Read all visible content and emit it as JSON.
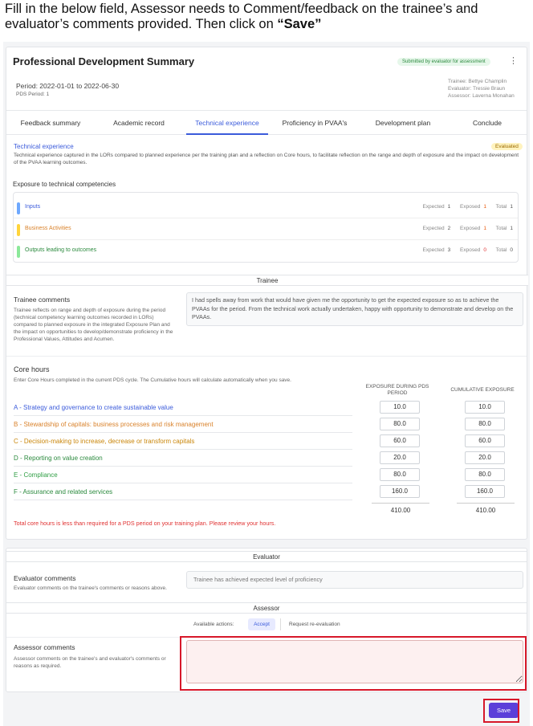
{
  "instruction": {
    "text": "Fill in the below field, Assessor needs to Comment/feedback on the trainee’s and evaluator’s comments provided. Then click on ",
    "emphasis": "“Save”"
  },
  "header": {
    "title": "Professional Development Summary",
    "status_badge": "Submitted by evaluator for assessment",
    "period": "Period: 2022-01-01 to 2022-06-30",
    "pds_period": "PDS Period: 1",
    "trainee": "Trainee:  Bettye Champlin",
    "evaluator": "Evaluator:  Tressie Braun",
    "assessor": "Assessor:  Laverna Monahan"
  },
  "tabs": [
    "Feedback summary",
    "Academic record",
    "Technical experience",
    "Proficiency in PVAA's",
    "Development plan",
    "Conclude"
  ],
  "tech": {
    "title": "Technical experience",
    "badge": "Evaluated",
    "description": "Technical experience captured in the LORs compared to planned experience per the training plan and a reflection on Core hours, to facilitate reflection on the range and depth of exposure and the impact on development of the PVAA learning outcomes.",
    "exposure_heading": "Exposure to technical competencies",
    "competencies": [
      {
        "label": "Inputs",
        "color": "#6ea8fe",
        "text_color": "#3b5bdb",
        "expected": "1",
        "exposed": "1",
        "total": "1",
        "exposed_color": "#e8590c"
      },
      {
        "label": "Business Activities",
        "color": "#ffd43b",
        "text_color": "#d9822b",
        "expected": "2",
        "exposed": "1",
        "total": "1",
        "exposed_color": "#e8590c"
      },
      {
        "label": "Outputs leading to outcomes",
        "color": "#8ce99a",
        "text_color": "#2b8a3e",
        "expected": "3",
        "exposed": "0",
        "total": "0",
        "exposed_color": "#e03131"
      }
    ],
    "labels": {
      "expected": "Expected",
      "exposed": "Exposed",
      "total": "Total"
    }
  },
  "trainee": {
    "section": "Trainee",
    "comments_title": "Trainee comments",
    "comments_help": "Trainee reflects on range and depth of exposure during the period (technical competency learning outcomes recorded in LORs) compared to planned exposure in the integrated Exposure Plan and the impact on opportunities to develop/demonstrate proficiency in the Professional Values, Attitudes and Acumen.",
    "comment_value": "I had spells away from work that would have given me the opportunity to get the expected exposure so as to achieve the PVAAs for the period. From the technical work actually undertaken, happy with opportunity to demonstrate and develop on the PVAAs."
  },
  "core_hours": {
    "title": "Core hours",
    "help": "Enter Core Hours completed in the current PDS cycle. The Cumulative hours will calculate automatically when you save.",
    "col_period": "EXPOSURE DURING PDS PERIOD",
    "col_cumulative": "CUMULATIVE EXPOSURE",
    "rows": [
      {
        "label": "A - Strategy and governance to create sustainable value",
        "color": "#3b5bdb",
        "period": "10.0",
        "cumulative": "10.0"
      },
      {
        "label": "B - Stewardship of capitals: business processes and risk management",
        "color": "#d9822b",
        "period": "80.0",
        "cumulative": "80.0"
      },
      {
        "label": "C - Decision-making to increase, decrease or transform capitals",
        "color": "#c9860a",
        "period": "60.0",
        "cumulative": "60.0"
      },
      {
        "label": "D - Reporting on value creation",
        "color": "#2b8a3e",
        "period": "20.0",
        "cumulative": "20.0"
      },
      {
        "label": "E - Compliance",
        "color": "#2f9e44",
        "period": "80.0",
        "cumulative": "80.0"
      },
      {
        "label": "F - Assurance and related services",
        "color": "#2b8a3e",
        "period": "160.0",
        "cumulative": "160.0"
      }
    ],
    "total_period": "410.00",
    "total_cumulative": "410.00",
    "warning": "Total core hours is less than required for a PDS period on your training plan. Please review your hours."
  },
  "evaluator": {
    "section": "Evaluator",
    "comments_title": "Evaluator comments",
    "comments_help": "Evaluator comments on the trainee's comments or reasons above.",
    "comment_value": "Trainee has achieved expected level of proficiency"
  },
  "assessor": {
    "section": "Assessor",
    "actions_label": "Available actions:",
    "accept_label": "Accept",
    "reeval_label": "Request re-evaluation",
    "comments_title": "Assessor comments",
    "comments_help": "Assessor comments on the trainee's and evaluator's comments or reasons as required.",
    "comment_value": ""
  },
  "save_label": "Save",
  "colors": {
    "accent": "#3b5bdb",
    "save": "#5b3fd9",
    "highlight": "#d7182a",
    "warning": "#e03131"
  }
}
